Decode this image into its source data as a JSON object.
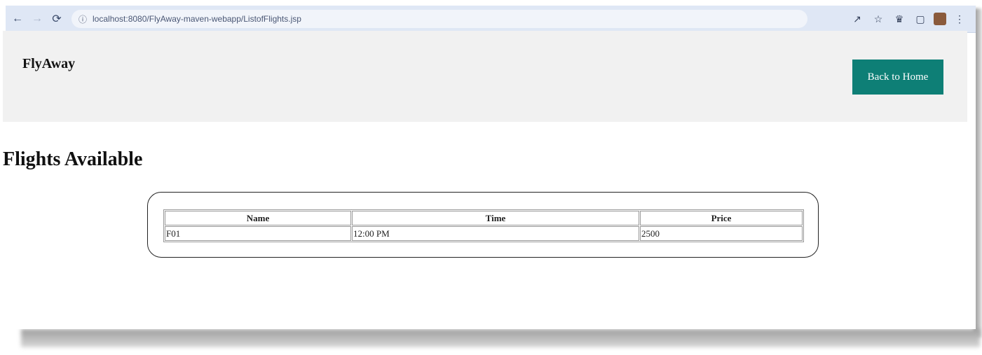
{
  "browser": {
    "url": "localhost:8080/FlyAway-maven-webapp/ListofFlights.jsp",
    "icons": [
      "back-icon",
      "forward-icon",
      "reload-icon",
      "info-icon",
      "share-icon",
      "star-icon",
      "extensions-icon",
      "sidepanel-icon",
      "profile-avatar",
      "menu-icon"
    ]
  },
  "header": {
    "brand": "FlyAway",
    "home_button": "Back to Home"
  },
  "main": {
    "title": "Flights Available",
    "table": {
      "columns": [
        "Name",
        "Time",
        "Price"
      ],
      "rows": [
        [
          "F01",
          "12:00 PM",
          "2500"
        ]
      ]
    }
  },
  "colors": {
    "accent": "#0e7f76",
    "header_bg": "#f1f1f1",
    "browser_bar": "#dfe7f5"
  }
}
